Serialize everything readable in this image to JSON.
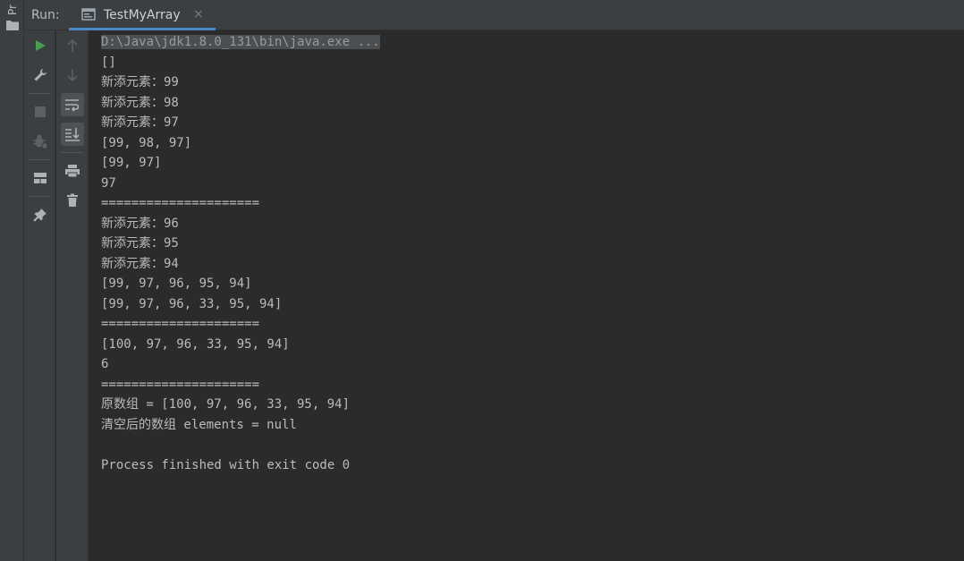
{
  "project_strip": {
    "label": "Pr"
  },
  "header": {
    "run_label": "Run:",
    "tab": {
      "label": "TestMyArray",
      "close": "×"
    }
  },
  "colors": {
    "background": "#2b2b2b",
    "panel": "#3c3f41",
    "run_green": "#499c54",
    "tab_underline": "#4a88c7",
    "text": "#bbbbbb"
  },
  "toolbar_left": [
    "run-icon",
    "wrench-icon",
    "stop-icon",
    "debug-bug-icon",
    "layout-icon",
    "pin-icon"
  ],
  "toolbar_right": [
    "arrow-up-icon",
    "arrow-down-icon",
    "soft-wrap-icon",
    "scroll-to-end-icon",
    "print-icon",
    "trash-icon"
  ],
  "console": {
    "lines": [
      "D:\\Java\\jdk1.8.0_131\\bin\\java.exe ...",
      "[]",
      "新添元素：99",
      "新添元素：98",
      "新添元素：97",
      "[99, 98, 97]",
      "[99, 97]",
      "97",
      "=====================",
      "新添元素：96",
      "新添元素：95",
      "新添元素：94",
      "[99, 97, 96, 95, 94]",
      "[99, 97, 96, 33, 95, 94]",
      "=====================",
      "[100, 97, 96, 33, 95, 94]",
      "6",
      "=====================",
      "原数组 = [100, 97, 96, 33, 95, 94]",
      "清空后的数组 elements = null",
      "",
      "Process finished with exit code 0"
    ]
  }
}
